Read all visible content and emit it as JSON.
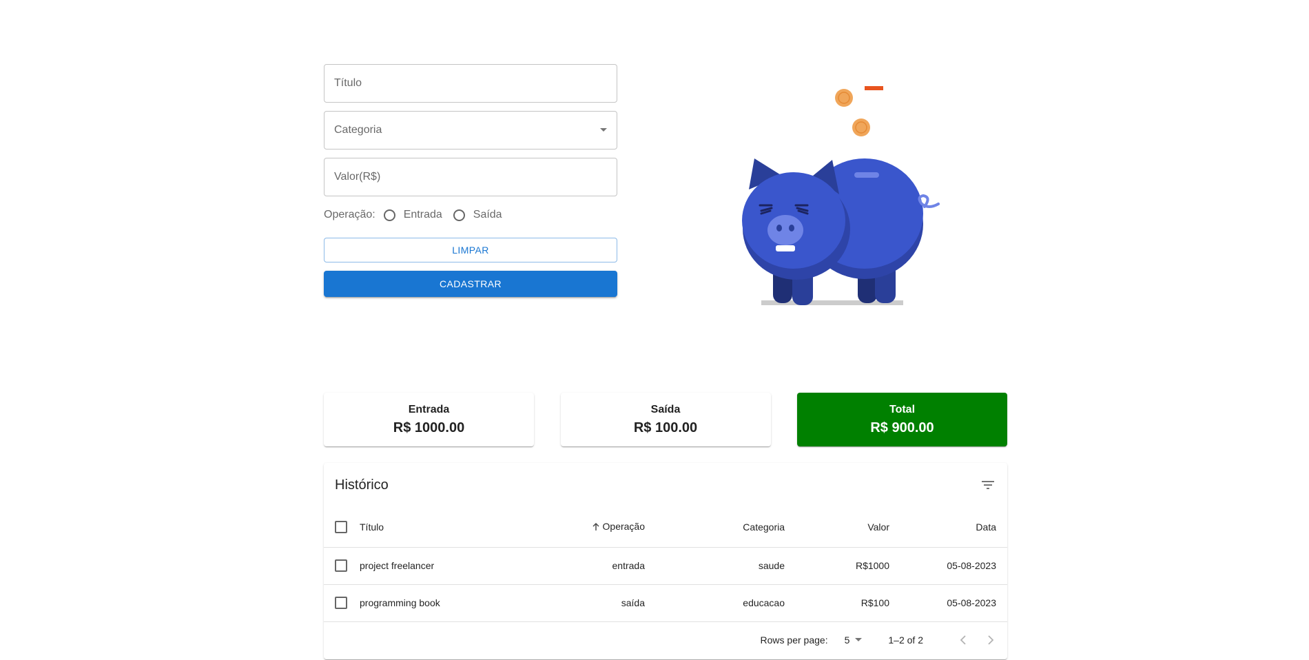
{
  "form": {
    "title_placeholder": "Título",
    "category_label": "Categoria",
    "value_placeholder": "Valor(R$)",
    "operation_label": "Operação:",
    "operation_options": [
      "Entrada",
      "Saída"
    ],
    "clear_button": "LIMPAR",
    "submit_button": "CADASTRAR"
  },
  "summary": {
    "entrada": {
      "title": "Entrada",
      "value": "R$ 1000.00"
    },
    "saida": {
      "title": "Saída",
      "value": "R$ 100.00"
    },
    "total": {
      "title": "Total",
      "value": "R$ 900.00"
    }
  },
  "history": {
    "title": "Histórico",
    "columns": [
      "Título",
      "Operação",
      "Categoria",
      "Valor",
      "Data"
    ],
    "rows": [
      {
        "titulo": "project freelancer",
        "operacao": "entrada",
        "categoria": "saude",
        "valor": "R$1000",
        "data": "05-08-2023"
      },
      {
        "titulo": "programming book",
        "operacao": "saída",
        "categoria": "educacao",
        "valor": "R$100",
        "data": "05-08-2023"
      }
    ],
    "pagination": {
      "rows_per_page_label": "Rows per page:",
      "rows_per_page_value": "5",
      "range": "1–2 of 2"
    }
  },
  "icons": [
    "chevron-down-icon",
    "filter-list-icon",
    "arrow-up-icon",
    "chevron-left-icon",
    "chevron-right-icon",
    "piggy-bank-illustration"
  ],
  "colors": {
    "primary": "#1976d2",
    "total_card": "#008000",
    "pig": "#3a56cc"
  }
}
